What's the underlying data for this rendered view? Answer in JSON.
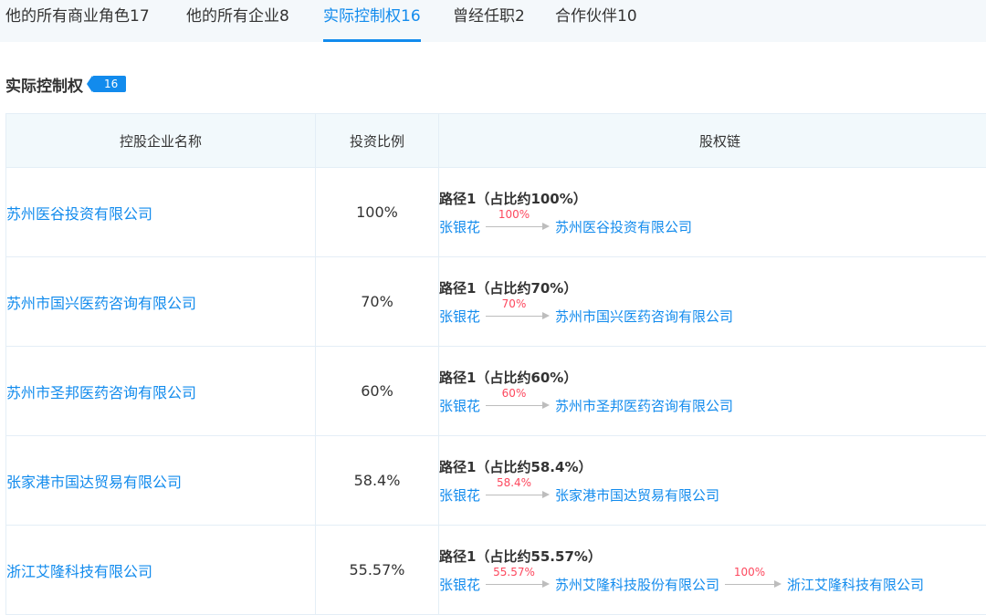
{
  "tabs": [
    {
      "label": "他的所有商业角色17",
      "active": false
    },
    {
      "label": "他的所有企业8",
      "active": false
    },
    {
      "label": "实际控制权16",
      "active": true
    },
    {
      "label": "曾经任职2",
      "active": false
    },
    {
      "label": "合作伙伴10",
      "active": false
    }
  ],
  "section": {
    "title": "实际控制权",
    "count": "16"
  },
  "table": {
    "headers": {
      "name": "控股企业名称",
      "ratio": "投资比例",
      "chain": "股权链"
    },
    "rows": [
      {
        "name": "苏州医谷投资有限公司",
        "ratio": "100%",
        "path_title": "路径1（占比约100%）",
        "chain": {
          "person": "张银花",
          "links": [
            {
              "pct": "100%",
              "to": "苏州医谷投资有限公司"
            }
          ]
        }
      },
      {
        "name": "苏州市国兴医药咨询有限公司",
        "ratio": "70%",
        "path_title": "路径1（占比约70%）",
        "chain": {
          "person": "张银花",
          "links": [
            {
              "pct": "70%",
              "to": "苏州市国兴医药咨询有限公司"
            }
          ]
        }
      },
      {
        "name": "苏州市圣邦医药咨询有限公司",
        "ratio": "60%",
        "path_title": "路径1（占比约60%）",
        "chain": {
          "person": "张银花",
          "links": [
            {
              "pct": "60%",
              "to": "苏州市圣邦医药咨询有限公司"
            }
          ]
        }
      },
      {
        "name": "张家港市国达贸易有限公司",
        "ratio": "58.4%",
        "path_title": "路径1（占比约58.4%）",
        "chain": {
          "person": "张银花",
          "links": [
            {
              "pct": "58.4%",
              "to": "张家港市国达贸易有限公司"
            }
          ]
        }
      },
      {
        "name": "浙江艾隆科技有限公司",
        "ratio": "55.57%",
        "path_title": "路径1（占比约55.57%）",
        "chain": {
          "person": "张银花",
          "links": [
            {
              "pct": "55.57%",
              "to": "苏州艾隆科技股份有限公司"
            },
            {
              "pct": "100%",
              "to": "浙江艾隆科技有限公司"
            }
          ]
        }
      }
    ]
  },
  "colors": {
    "accent": "#128bed",
    "percent": "#fd485e",
    "header_bg": "#f2f9fc",
    "tabbar_bg": "#f4f8fb"
  }
}
